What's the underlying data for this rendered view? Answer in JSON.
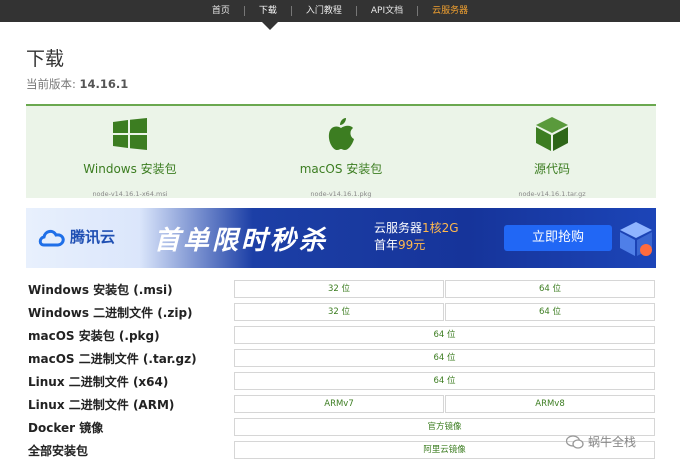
{
  "nav": {
    "items": [
      "首页",
      "下载",
      "入门教程",
      "API文档",
      "云服务器"
    ],
    "active": "下载"
  },
  "page": {
    "title": "下载",
    "version_label": "当前版本:",
    "version": "14.16.1"
  },
  "downloads": [
    {
      "icon": "windows-icon",
      "label": "Windows 安装包",
      "file": "node-v14.16.1-x64.msi"
    },
    {
      "icon": "apple-icon",
      "label": "macOS 安装包",
      "file": "node-v14.16.1.pkg"
    },
    {
      "icon": "cube-icon",
      "label": "源代码",
      "file": "node-v14.16.1.tar.gz"
    }
  ],
  "banner": {
    "brand": "腾讯云",
    "slogan": "首单限时秒杀",
    "promo_line1": "云服务器",
    "promo_line1_hl": "1核2G",
    "promo_line2": "首年",
    "promo_line2_hl": "99元",
    "cta": "立即抢购"
  },
  "table": [
    {
      "label": "Windows 安装包 (.msi)",
      "cells": [
        "32 位",
        "64 位"
      ]
    },
    {
      "label": "Windows 二进制文件 (.zip)",
      "cells": [
        "32 位",
        "64 位"
      ]
    },
    {
      "label": "macOS 安装包 (.pkg)",
      "cells": [
        "64 位"
      ]
    },
    {
      "label": "macOS 二进制文件 (.tar.gz)",
      "cells": [
        "64 位"
      ]
    },
    {
      "label": "Linux 二进制文件 (x64)",
      "cells": [
        "64 位"
      ]
    },
    {
      "label": "Linux 二进制文件 (ARM)",
      "cells": [
        "ARMv7",
        "ARMv8"
      ]
    },
    {
      "label": "Docker 镜像",
      "cells": [
        "官方镜像"
      ]
    },
    {
      "label": "全部安装包",
      "cells": [
        "阿里云镜像"
      ]
    }
  ],
  "watermark": "蜗牛全栈",
  "colors": {
    "accent_green": "#3c7d21",
    "nav_bg": "#333333",
    "highlight_orange": "#f0a030"
  }
}
